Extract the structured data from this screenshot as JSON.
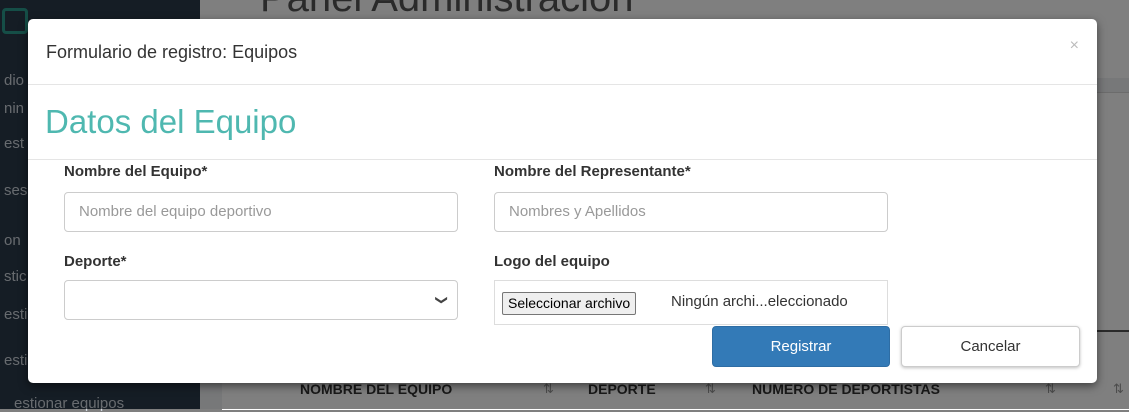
{
  "background": {
    "page_title": "Panel Administracion",
    "sidebar_fragments": [
      "dio",
      "nin",
      "est",
      "ses",
      "on",
      "stic",
      "esti",
      "esti",
      "estionar equipos"
    ],
    "table_headers": [
      "NOMBRE DEL EQUIPO",
      "DEPORTE",
      "NUMERO DE DEPORTISTAS"
    ]
  },
  "modal": {
    "title": "Formulario de registro: Equipos",
    "close_label": "×",
    "section_title": "Datos del Equipo",
    "team_name": {
      "label": "Nombre del Equipo*",
      "placeholder": "Nombre del equipo deportivo",
      "value": ""
    },
    "representative": {
      "label": "Nombre del Representante*",
      "placeholder": "Nombres y Apellidos",
      "value": ""
    },
    "sport": {
      "label": "Deporte*",
      "selected": ""
    },
    "logo": {
      "label": "Logo del equipo",
      "button_label": "Seleccionar archivo",
      "status_text": "Ningún archi...eleccionado"
    },
    "submit_label": "Registrar",
    "cancel_label": "Cancelar"
  },
  "colors": {
    "accent": "#4fb8b0",
    "primary": "#337ab7"
  }
}
